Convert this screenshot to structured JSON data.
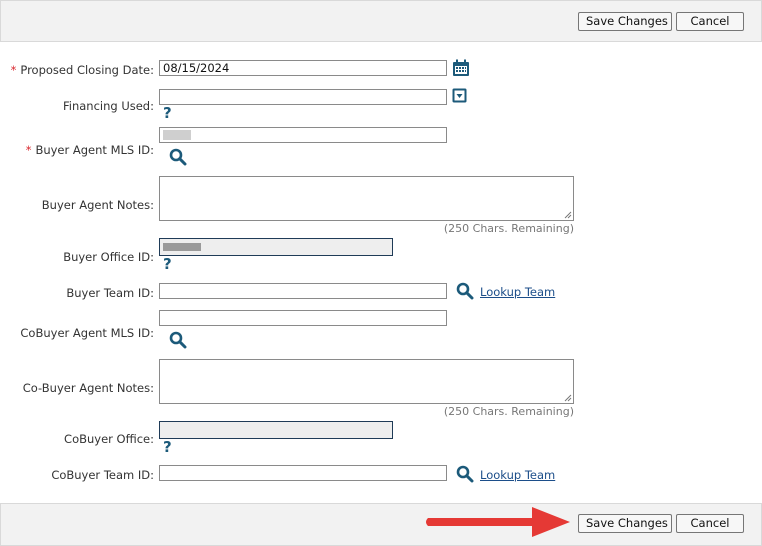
{
  "toolbar_top": {
    "save_label": "Save Changes",
    "cancel_label": "Cancel"
  },
  "toolbar_bottom": {
    "save_label": "Save Changes",
    "cancel_label": "Cancel"
  },
  "form": {
    "closing_date": {
      "label": "Proposed Closing Date:",
      "value": "08/15/2024",
      "required": true
    },
    "financing": {
      "label": "Financing Used:",
      "value": ""
    },
    "buyer_agent_mls": {
      "label": "Buyer Agent MLS ID:",
      "required": true
    },
    "buyer_agent_notes": {
      "label": "Buyer Agent Notes:",
      "remaining": "(250 Chars. Remaining)"
    },
    "buyer_office": {
      "label": "Buyer Office ID:"
    },
    "buyer_team": {
      "label": "Buyer Team ID:",
      "lookup": "Lookup Team"
    },
    "cobuyer_agent_mls": {
      "label": "CoBuyer Agent MLS ID:"
    },
    "cobuyer_agent_notes": {
      "label": "Co-Buyer Agent Notes:",
      "remaining": "(250 Chars. Remaining)"
    },
    "cobuyer_office": {
      "label": "CoBuyer Office:"
    },
    "cobuyer_team": {
      "label": "CoBuyer Team ID:",
      "lookup": "Lookup Team"
    }
  },
  "required_mark": "*",
  "help_glyph": "?",
  "colors": {
    "accent": "#1c5a7a",
    "required": "#d9272e",
    "arrow": "#e53935"
  },
  "icons": [
    "calendar-icon",
    "dropdown-icon",
    "help-icon",
    "search-icon",
    "red-arrow"
  ]
}
